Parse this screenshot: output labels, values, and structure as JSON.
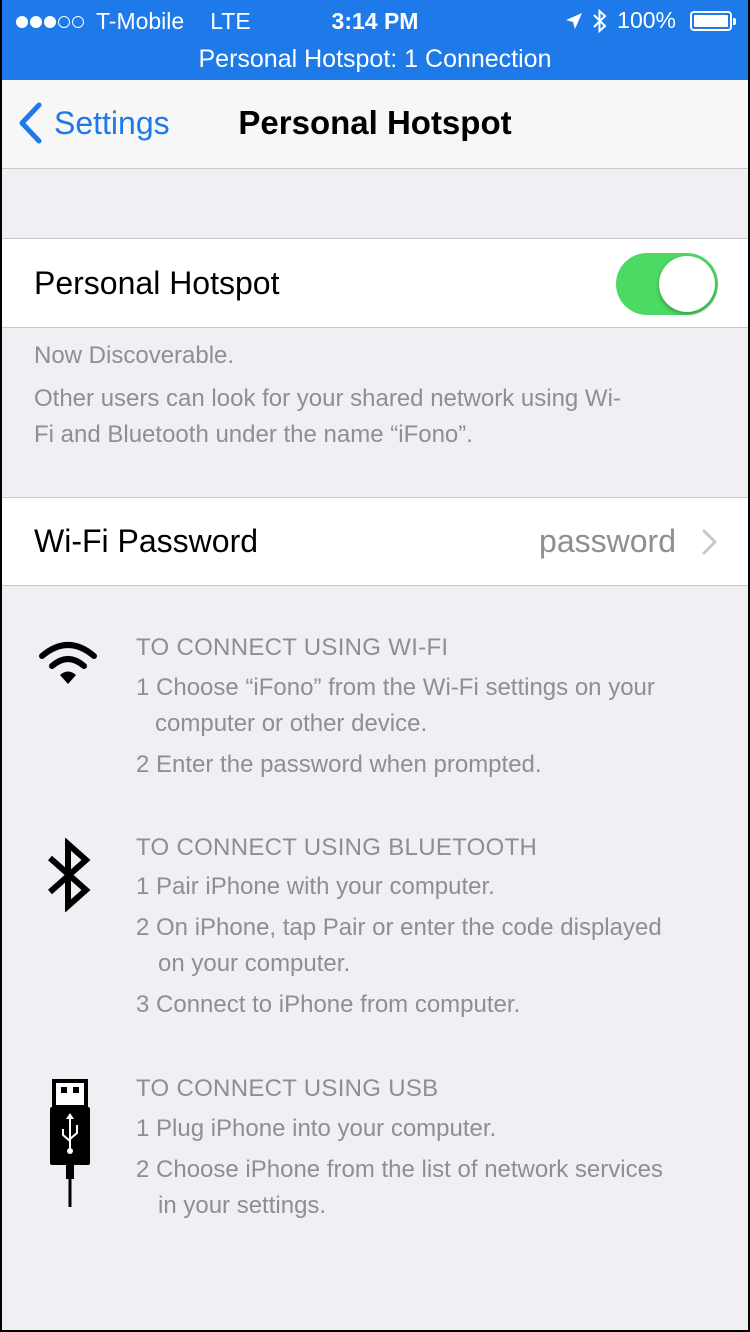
{
  "status_bar": {
    "signal_dots": [
      true,
      true,
      true,
      false,
      false
    ],
    "carrier": "T-Mobile",
    "network": "LTE",
    "time": "3:14 PM",
    "battery": "100%"
  },
  "banner": {
    "text": "Personal Hotspot: 1 Connection"
  },
  "nav": {
    "back_label": "Settings",
    "title": "Personal Hotspot"
  },
  "hotspot": {
    "label": "Personal Hotspot",
    "enabled": true,
    "toggle_color": "#4cd964"
  },
  "discoverable": {
    "line1": "Now Discoverable.",
    "line2a": "Other users can look for your shared network using Wi-",
    "line2b": "Fi and Bluetooth under the name “iFono”."
  },
  "wifi_password": {
    "label": "Wi-Fi Password",
    "value": "password"
  },
  "instructions": {
    "wifi": {
      "header": "TO CONNECT USING WI-FI",
      "step1_num": "1",
      "step1a": "Choose “iFono” from the Wi-Fi settings on your",
      "step1b": "computer or other device.",
      "step2": "2 Enter the password when prompted."
    },
    "bluetooth": {
      "header": "TO CONNECT USING BLUETOOTH",
      "step1": "1 Pair iPhone with your computer.",
      "step2a": "2 On iPhone, tap Pair or enter the code displayed",
      "step2b": "on your computer.",
      "step3": "3 Connect to iPhone from computer."
    },
    "usb": {
      "header": "TO CONNECT USING USB",
      "step1": "1 Plug iPhone into your computer.",
      "step2a": "2 Choose iPhone from the list of network services",
      "step2b": "in your settings."
    }
  },
  "colors": {
    "accent": "#1e7ae8",
    "secondary_text": "#8e8e93",
    "background": "#efeff4"
  }
}
